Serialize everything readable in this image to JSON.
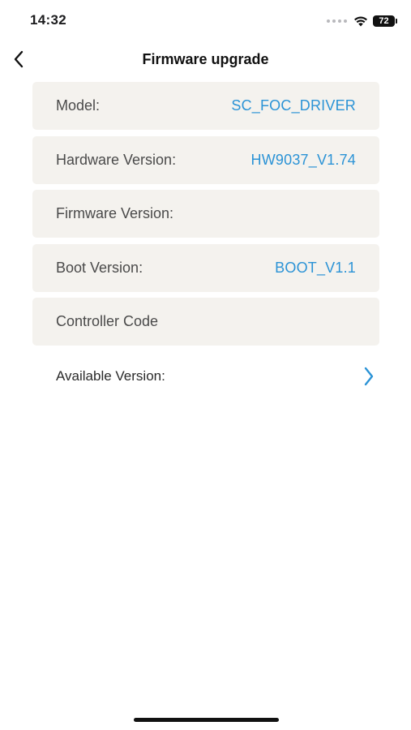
{
  "status_bar": {
    "time": "14:32",
    "battery_level": "72"
  },
  "nav": {
    "title": "Firmware upgrade",
    "back_icon": "chevron-left-icon"
  },
  "info_rows": [
    {
      "label": "Model:",
      "value": "SC_FOC_DRIVER"
    },
    {
      "label": "Hardware Version:",
      "value": "HW9037_V1.74"
    },
    {
      "label": "Firmware Version:",
      "value": ""
    },
    {
      "label": "Boot Version:",
      "value": "BOOT_V1.1"
    },
    {
      "label": "Controller Code",
      "value": ""
    }
  ],
  "available": {
    "label": "Available Version:",
    "icon": "chevron-right-icon"
  },
  "colors": {
    "accent": "#2b93d6",
    "card_background": "#f4f2ee",
    "label_text": "#4a4a4a"
  }
}
